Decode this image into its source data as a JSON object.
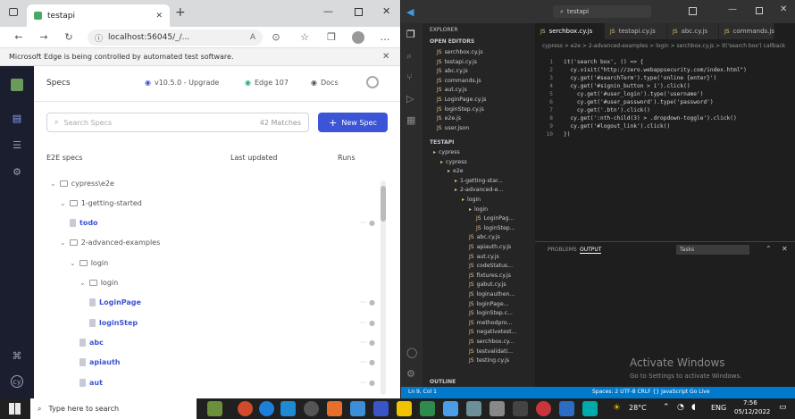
{
  "edge": {
    "tab_title": "testapi",
    "url": "localhost:56045/_/...",
    "info_bar": "Microsoft Edge is being controlled by automated test software."
  },
  "cypress": {
    "page_title": "Specs",
    "version": "v10.5.0 - Upgrade",
    "browser": "Edge 107",
    "docs": "Docs",
    "search_placeholder": "Search Specs",
    "matches": "42 Matches",
    "new_spec": "New Spec",
    "col_specs": "E2E specs",
    "col_updated": "Last updated",
    "col_runs": "Runs",
    "tree": [
      {
        "label": "cypress\\e2e",
        "kind": "folder",
        "indent": 0
      },
      {
        "label": "1-getting-started",
        "kind": "folder",
        "indent": 1
      },
      {
        "label": "todo",
        "kind": "file",
        "indent": 2
      },
      {
        "label": "2-advanced-examples",
        "kind": "folder",
        "indent": 1
      },
      {
        "label": "login",
        "kind": "folder",
        "indent": 2
      },
      {
        "label": "login",
        "kind": "folder",
        "indent": 3
      },
      {
        "label": "LoginPage",
        "kind": "file",
        "indent": 4
      },
      {
        "label": "loginStep",
        "kind": "file",
        "indent": 4
      },
      {
        "label": "abc",
        "kind": "file",
        "indent": 3
      },
      {
        "label": "apiauth",
        "kind": "file",
        "indent": 3
      },
      {
        "label": "aut",
        "kind": "file",
        "indent": 3
      }
    ]
  },
  "vscode": {
    "title": "testapi",
    "tabs": [
      "serchbox.cy.js",
      "testapi.cy.js",
      "abc.cy.js",
      "commands.js"
    ],
    "breadcrumb": "cypress > e2e > 2-advanced-examples > login > serchbox.cy.js > it('search box') callback",
    "code": [
      "it('search box', () => {",
      "  cy.visit(\"http://zero.webappsecurity.com/index.html\")",
      "  cy.get('#searchTerm').type('online {enter}')",
      "  cy.get('#signin_button > i').click()",
      "    cy.get('#user_login').type('username')",
      "    cy.get('#user_password').type('password')",
      "    cy.get('.btn').click()",
      "  cy.get(':nth-child(3) > .dropdown-toggle').click()",
      "  cy.get('#logout_link').click()",
      "})"
    ],
    "explorer_header": "EXPLORER",
    "open_editors": "OPEN EDITORS",
    "open_files": [
      "serchbox.cy.js",
      "testapi.cy.js",
      "abc.cy.js",
      "commands.js",
      "aut.cy.js",
      "LoginPage.cy.js",
      "loginStep.cy.js",
      "e2e.js",
      "user.json"
    ],
    "project": "TESTAPI",
    "project_items": [
      "cypress",
      "cypress",
      "e2e",
      "1-getting-star...",
      "2-advanced-e...",
      "login",
      "login",
      "LoginPag...",
      "loginStep...",
      "abc.cy.js",
      "apiauth.cy.js",
      "aut.cy.js",
      "codeStatus...",
      "fixtures.cy.js",
      "gabut.cy.js",
      "loginauthen...",
      "loginPage...",
      "loginStep.c...",
      "methodpro...",
      "negativetest...",
      "serchbox.cy...",
      "testvalidati...",
      "testing.cy.js"
    ],
    "outline": "OUTLINE",
    "panel_tabs": [
      "PROBLEMS",
      "OUTPUT"
    ],
    "panel_select": "Tasks",
    "activate_title": "Activate Windows",
    "activate_sub": "Go to Settings to activate Windows.",
    "status_left": "Ln 9, Col 1",
    "status_right": "Spaces: 2  UTF-8  CRLF  {} JavaScript  Go Live"
  },
  "taskbar": {
    "search": "Type here to search",
    "temp": "28°C",
    "lang": "ENG",
    "time": "7:56",
    "date": "05/12/2022"
  }
}
